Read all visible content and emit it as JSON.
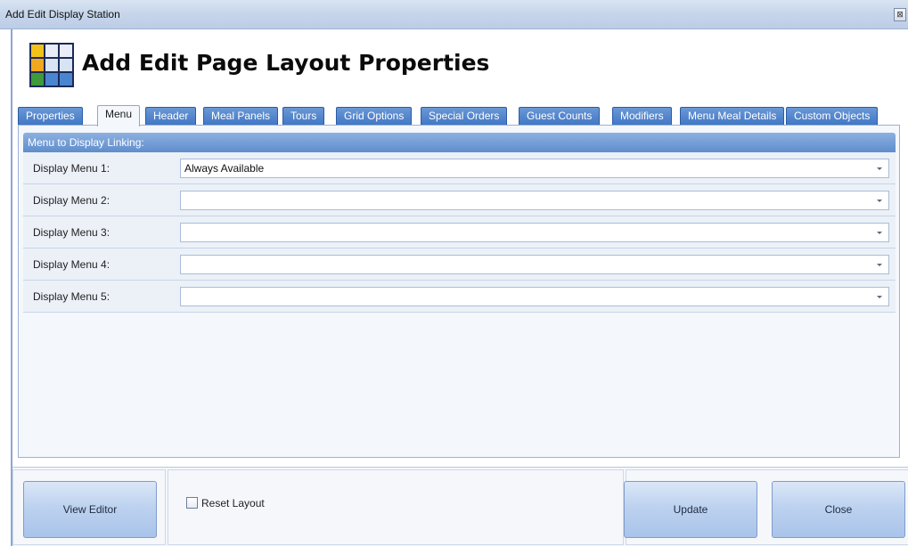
{
  "window": {
    "title": "Add Edit Display Station",
    "close_glyph": "⊠"
  },
  "header": {
    "title": "Add Edit Page Layout Properties",
    "icon": "grid-table-icon"
  },
  "tabs": [
    {
      "label": "Properties",
      "active": false
    },
    {
      "label": "Menu",
      "active": true
    },
    {
      "label": "Header",
      "active": false
    },
    {
      "label": "Meal Panels",
      "active": false
    },
    {
      "label": "Tours",
      "active": false
    },
    {
      "label": "Grid Options",
      "active": false
    },
    {
      "label": "Special Orders",
      "active": false
    },
    {
      "label": "Guest Counts",
      "active": false
    },
    {
      "label": "Modifiers",
      "active": false
    },
    {
      "label": "Menu Meal Details",
      "active": false
    },
    {
      "label": "Custom Objects",
      "active": false
    }
  ],
  "menu_panel": {
    "group_title": "Menu to Display Linking:",
    "rows": [
      {
        "label": "Display Menu 1:",
        "value": "Always Available"
      },
      {
        "label": "Display Menu 2:",
        "value": ""
      },
      {
        "label": "Display Menu 3:",
        "value": ""
      },
      {
        "label": "Display Menu 4:",
        "value": ""
      },
      {
        "label": "Display Menu 5:",
        "value": ""
      }
    ]
  },
  "footer": {
    "view_editor_label": "View Editor",
    "reset_layout_label": "Reset Layout",
    "reset_layout_checked": false,
    "update_label": "Update",
    "close_label": "Close"
  },
  "colors": {
    "tab_blue": "#4a7fca",
    "group_header": "#7aa0d8",
    "button_blue": "#bdd2ef"
  }
}
